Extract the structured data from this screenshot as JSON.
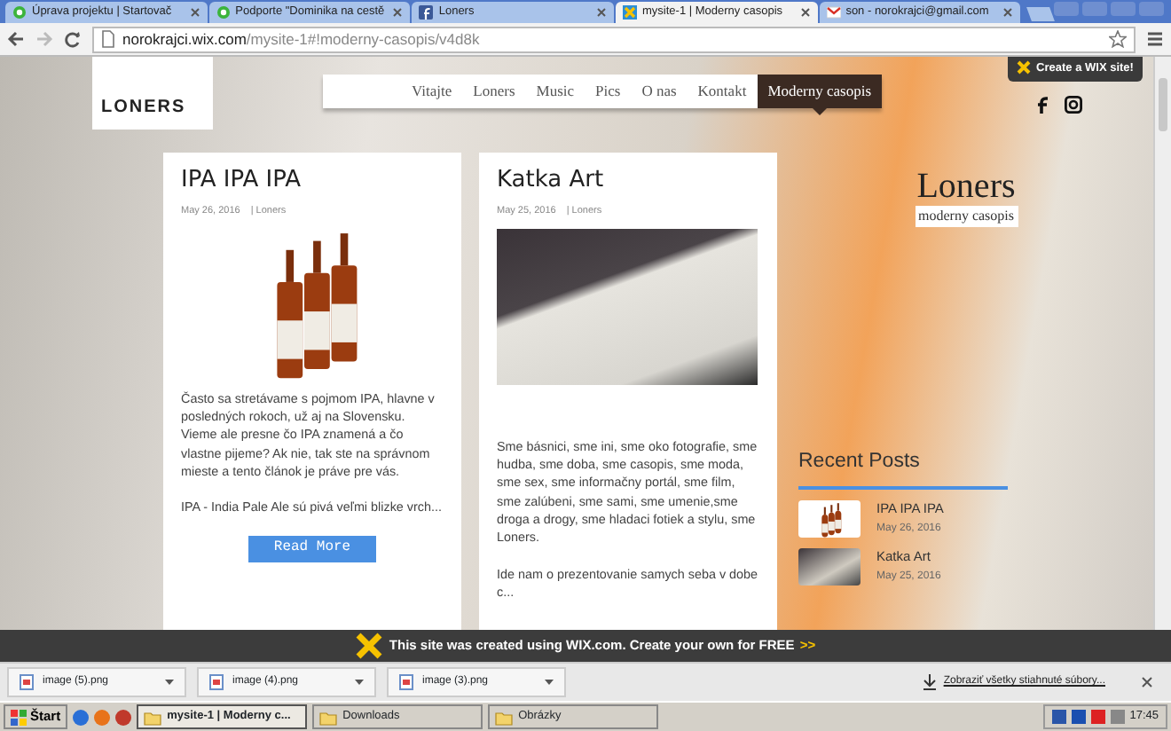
{
  "browser": {
    "tabs": [
      {
        "title": "Úprava projektu | Startovač",
        "selected": false
      },
      {
        "title": "Podporte \"Dominika na cestě",
        "selected": false
      },
      {
        "title": "Loners",
        "selected": false
      },
      {
        "title": "mysite-1 | Moderny casopis",
        "selected": true
      },
      {
        "title": "son - norokrajci@gmail.com",
        "selected": false
      }
    ],
    "address": {
      "host": "norokrajci.wix.com",
      "path": "/mysite-1#!moderny-casopis/v4d8k"
    }
  },
  "site": {
    "logo": "LONERS",
    "nav": [
      {
        "label": "Vitajte",
        "selected": false
      },
      {
        "label": "Loners",
        "selected": false
      },
      {
        "label": "Music",
        "selected": false
      },
      {
        "label": "Pics",
        "selected": false
      },
      {
        "label": "O nas",
        "selected": false
      },
      {
        "label": "Kontakt",
        "selected": false
      },
      {
        "label": "Moderny casopis",
        "selected": true
      }
    ],
    "wix_badge": "Create a **WIX** site!",
    "posts": [
      {
        "title": "IPA IPA IPA",
        "date": "May 26, 2016",
        "author": "| Loners",
        "paragraphs": [
          "Často sa stretávame s pojmom IPA, hlavne v posledných rokoch, už aj na Slovensku. Vieme ale presne čo IPA znamená a čo vlastne pijeme? Ak nie, tak ste na správnom mieste a tento článok je práve pre vás.",
          "IPA - India Pale Ale sú pivá veľmi blizke vrch..."
        ],
        "button": "Read More"
      },
      {
        "title": "Katka Art",
        "date": "May 25, 2016",
        "author": "| Loners",
        "paragraphs": [
          "Sme básnici, sme ini, sme oko fotografie, sme hudba, sme doba, sme casopis, sme moda, sme sex, sme informačny portál, sme film, sme zalúbeni, sme sami, sme umenie,sme droga a drogy, sme hladaci fotiek a stylu, sme Loners.",
          "Ide nam o prezentovanie samych seba v dobe c..."
        ]
      }
    ],
    "sidebar": {
      "title": "Loners",
      "subtitle": "moderny casopis",
      "recent_title": "Recent Posts",
      "recent": [
        {
          "title": "IPA IPA IPA",
          "date": "May 26, 2016"
        },
        {
          "title": "Katka Art",
          "date": "May 25, 2016"
        }
      ]
    }
  },
  "wix_banner": {
    "text": "This site was created using WIX.com. Create your own for FREE",
    "arrows": ">>"
  },
  "downloads": {
    "files": [
      "image (5).png",
      "image (4).png",
      "image (3).png"
    ],
    "show_all": "Zobraziť všetky stiahnuté súbory..."
  },
  "taskbar": {
    "start": "Štart",
    "tasks": [
      {
        "label": "mysite-1 | Moderny c...",
        "selected": true
      },
      {
        "label": "Downloads",
        "selected": false
      },
      {
        "label": "Obrázky",
        "selected": false
      }
    ],
    "clock": "17:45"
  }
}
